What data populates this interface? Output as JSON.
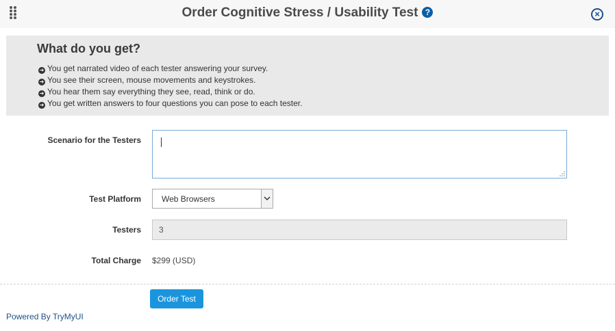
{
  "dialog": {
    "title": "Order Cognitive Stress / Usability Test",
    "help_icon": "?",
    "close_icon": "×"
  },
  "info": {
    "heading": "What do you get?",
    "items": [
      "You get narrated video of each tester answering your survey.",
      "You see their screen, mouse movements and keystrokes.",
      "You hear them say everything they see, read, think or do.",
      "You get written answers to four questions you can pose to each tester."
    ]
  },
  "form": {
    "scenario_label": "Scenario for the Testers",
    "scenario_value": "",
    "platform_label": "Test Platform",
    "platform_value": "Web Browsers",
    "testers_label": "Testers",
    "testers_value": "3",
    "total_label": "Total Charge",
    "total_value": "$299 (USD)"
  },
  "footer": {
    "order_button": "Order Test",
    "powered_by": "Powered By TryMyUI"
  },
  "colors": {
    "accent": "#1a95dd",
    "title_icon": "#0a5ea8",
    "link": "#1f4f86"
  }
}
